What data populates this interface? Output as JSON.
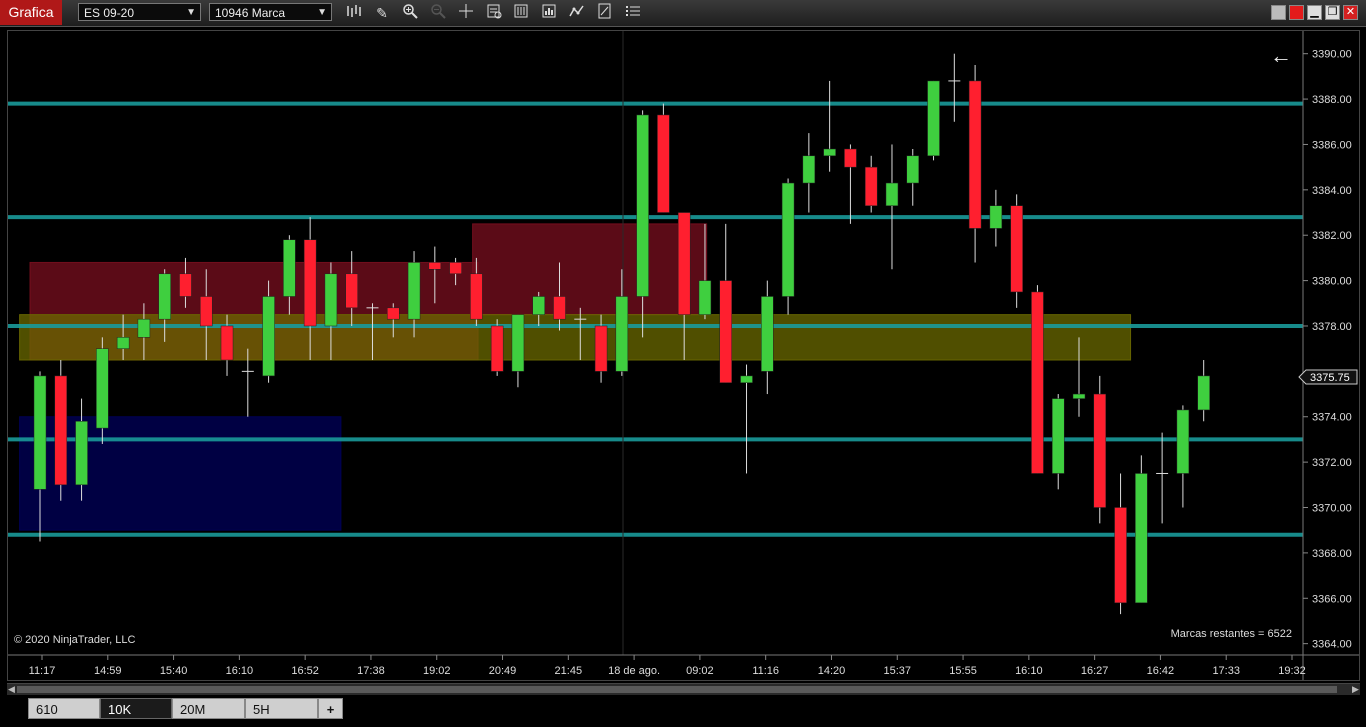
{
  "toolbar": {
    "app_title": "Grafica",
    "instrument": "ES 09-20",
    "bar_type": "10946 Marca",
    "icons": [
      "bars-icon",
      "pencil-icon",
      "zoom-in-icon",
      "zoom-out-icon",
      "crosshair-icon",
      "data-box-icon",
      "properties-icon",
      "strategy-icon",
      "indicators-icon",
      "notes-icon",
      "list-icon"
    ]
  },
  "chart": {
    "copyright": "© 2020 NinjaTrader, LLC",
    "remaining": "Marcas restantes = 6522",
    "back_arrow": "←",
    "current_price": "3375.75",
    "y_labels": [
      "3390.00",
      "3388.00",
      "3386.00",
      "3384.00",
      "3382.00",
      "3380.00",
      "3378.00",
      "3374.00",
      "3372.00",
      "3370.00",
      "3368.00",
      "3366.00",
      "3364.00"
    ],
    "x_labels": [
      "11:17",
      "14:59",
      "15:40",
      "16:10",
      "16:52",
      "17:38",
      "19:02",
      "20:49",
      "21:45",
      "18 de ago.",
      "09:02",
      "11:16",
      "14:20",
      "15:37",
      "15:55",
      "16:10",
      "16:27",
      "16:42",
      "17:33",
      "19:32"
    ],
    "colors": {
      "up": "#3fcf3f",
      "down": "#ff1f2f",
      "hline": "#1a9a9a",
      "background": "#000000"
    }
  },
  "chart_data": {
    "type": "candlestick",
    "ylim": [
      3363.5,
      3391
    ],
    "price_axis": "right",
    "current_price": 3375.75,
    "horizontal_lines": [
      3387.8,
      3382.8,
      3378.0,
      3373.0,
      3368.8
    ],
    "zones": [
      {
        "from": 0,
        "to": 20.6,
        "low": 3376.5,
        "high": 3380.8,
        "color": "#7a0f1f"
      },
      {
        "from": 21.3,
        "to": 31.6,
        "low": 3378.5,
        "high": 3382.5,
        "color": "#7a0f1f"
      },
      {
        "from": -0.5,
        "to": 52,
        "low": 3376.5,
        "high": 3378.5,
        "color": "#6b6a00"
      },
      {
        "from": -0.5,
        "to": 14,
        "low": 3369,
        "high": 3374,
        "color": "#00005a"
      }
    ],
    "candles": [
      {
        "o": 3370.8,
        "h": 3376,
        "l": 3368.5,
        "c": 3375.8
      },
      {
        "o": 3375.8,
        "h": 3376.5,
        "l": 3370.3,
        "c": 3371.0
      },
      {
        "o": 3371.0,
        "h": 3374.8,
        "l": 3370.3,
        "c": 3373.8
      },
      {
        "o": 3373.5,
        "h": 3377.5,
        "l": 3372.8,
        "c": 3377.0
      },
      {
        "o": 3377.0,
        "h": 3378.5,
        "l": 3376.5,
        "c": 3377.5
      },
      {
        "o": 3377.5,
        "h": 3379.0,
        "l": 3376.5,
        "c": 3378.3
      },
      {
        "o": 3378.3,
        "h": 3380.5,
        "l": 3377.3,
        "c": 3380.3
      },
      {
        "o": 3380.3,
        "h": 3381.0,
        "l": 3378.8,
        "c": 3379.3
      },
      {
        "o": 3379.3,
        "h": 3380.5,
        "l": 3376.5,
        "c": 3378.0
      },
      {
        "o": 3378.0,
        "h": 3378.5,
        "l": 3375.8,
        "c": 3376.5
      },
      {
        "o": 3376.0,
        "h": 3377.0,
        "l": 3374.0,
        "c": 3376.0
      },
      {
        "o": 3375.8,
        "h": 3380.0,
        "l": 3375.5,
        "c": 3379.3
      },
      {
        "o": 3379.3,
        "h": 3382.0,
        "l": 3378.5,
        "c": 3381.8
      },
      {
        "o": 3381.8,
        "h": 3382.8,
        "l": 3376.5,
        "c": 3378.0
      },
      {
        "o": 3378.0,
        "h": 3380.8,
        "l": 3376.5,
        "c": 3380.3
      },
      {
        "o": 3380.3,
        "h": 3381.3,
        "l": 3378.0,
        "c": 3378.8
      },
      {
        "o": 3378.8,
        "h": 3379.0,
        "l": 3376.5,
        "c": 3378.8
      },
      {
        "o": 3378.8,
        "h": 3379.0,
        "l": 3377.5,
        "c": 3378.3
      },
      {
        "o": 3378.3,
        "h": 3381.3,
        "l": 3377.5,
        "c": 3380.8
      },
      {
        "o": 3380.8,
        "h": 3381.5,
        "l": 3379.0,
        "c": 3380.5
      },
      {
        "o": 3380.8,
        "h": 3381.0,
        "l": 3379.8,
        "c": 3380.3
      },
      {
        "o": 3380.3,
        "h": 3381.0,
        "l": 3378.0,
        "c": 3378.3
      },
      {
        "o": 3378.0,
        "h": 3378.3,
        "l": 3375.8,
        "c": 3376.0
      },
      {
        "o": 3376.0,
        "h": 3378.5,
        "l": 3375.3,
        "c": 3378.5
      },
      {
        "o": 3378.5,
        "h": 3379.5,
        "l": 3378.0,
        "c": 3379.3
      },
      {
        "o": 3379.3,
        "h": 3380.8,
        "l": 3377.8,
        "c": 3378.3
      },
      {
        "o": 3378.3,
        "h": 3378.8,
        "l": 3376.5,
        "c": 3378.3
      },
      {
        "o": 3378.0,
        "h": 3378.5,
        "l": 3375.5,
        "c": 3376.0
      },
      {
        "o": 3376.0,
        "h": 3380.5,
        "l": 3375.8,
        "c": 3379.3
      },
      {
        "o": 3379.3,
        "h": 3387.5,
        "l": 3377.5,
        "c": 3387.3
      },
      {
        "o": 3387.3,
        "h": 3387.8,
        "l": 3383.0,
        "c": 3383.0
      },
      {
        "o": 3383.0,
        "h": 3383.0,
        "l": 3376.5,
        "c": 3378.5
      },
      {
        "o": 3378.5,
        "h": 3382.5,
        "l": 3378.3,
        "c": 3380.0
      },
      {
        "o": 3380.0,
        "h": 3382.5,
        "l": 3375.5,
        "c": 3375.5
      },
      {
        "o": 3375.5,
        "h": 3376.3,
        "l": 3371.5,
        "c": 3375.8
      },
      {
        "o": 3376.0,
        "h": 3380.0,
        "l": 3375.0,
        "c": 3379.3
      },
      {
        "o": 3379.3,
        "h": 3384.5,
        "l": 3378.5,
        "c": 3384.3
      },
      {
        "o": 3384.3,
        "h": 3386.5,
        "l": 3383.0,
        "c": 3385.5
      },
      {
        "o": 3385.5,
        "h": 3388.8,
        "l": 3384.8,
        "c": 3385.8
      },
      {
        "o": 3385.8,
        "h": 3386.0,
        "l": 3382.5,
        "c": 3385.0
      },
      {
        "o": 3385.0,
        "h": 3385.5,
        "l": 3383.0,
        "c": 3383.3
      },
      {
        "o": 3383.3,
        "h": 3386.0,
        "l": 3380.5,
        "c": 3384.3
      },
      {
        "o": 3384.3,
        "h": 3385.8,
        "l": 3383.3,
        "c": 3385.5
      },
      {
        "o": 3385.5,
        "h": 3388.8,
        "l": 3385.3,
        "c": 3388.8
      },
      {
        "o": 3388.8,
        "h": 3390.0,
        "l": 3387.0,
        "c": 3388.8
      },
      {
        "o": 3388.8,
        "h": 3389.5,
        "l": 3380.8,
        "c": 3382.3
      },
      {
        "o": 3382.3,
        "h": 3384.0,
        "l": 3381.5,
        "c": 3383.3
      },
      {
        "o": 3383.3,
        "h": 3383.8,
        "l": 3378.8,
        "c": 3379.5
      },
      {
        "o": 3379.5,
        "h": 3379.8,
        "l": 3371.5,
        "c": 3371.5
      },
      {
        "o": 3371.5,
        "h": 3375.0,
        "l": 3370.8,
        "c": 3374.8
      },
      {
        "o": 3374.8,
        "h": 3377.5,
        "l": 3374.0,
        "c": 3375.0
      },
      {
        "o": 3375.0,
        "h": 3375.8,
        "l": 3369.3,
        "c": 3370.0
      },
      {
        "o": 3370.0,
        "h": 3371.5,
        "l": 3365.3,
        "c": 3365.8
      },
      {
        "o": 3365.8,
        "h": 3372.3,
        "l": 3365.8,
        "c": 3371.5
      },
      {
        "o": 3371.5,
        "h": 3373.3,
        "l": 3369.3,
        "c": 3371.5
      },
      {
        "o": 3371.5,
        "h": 3374.5,
        "l": 3370.0,
        "c": 3374.3
      },
      {
        "o": 3374.3,
        "h": 3376.5,
        "l": 3373.8,
        "c": 3375.8
      }
    ]
  },
  "scrollbar": {
    "left": "◀",
    "right": "▶"
  },
  "tabs": [
    {
      "label": "610",
      "active": false
    },
    {
      "label": "10K",
      "active": true
    },
    {
      "label": "20M",
      "active": false
    },
    {
      "label": "5H",
      "active": false
    }
  ],
  "add_tab": "+"
}
